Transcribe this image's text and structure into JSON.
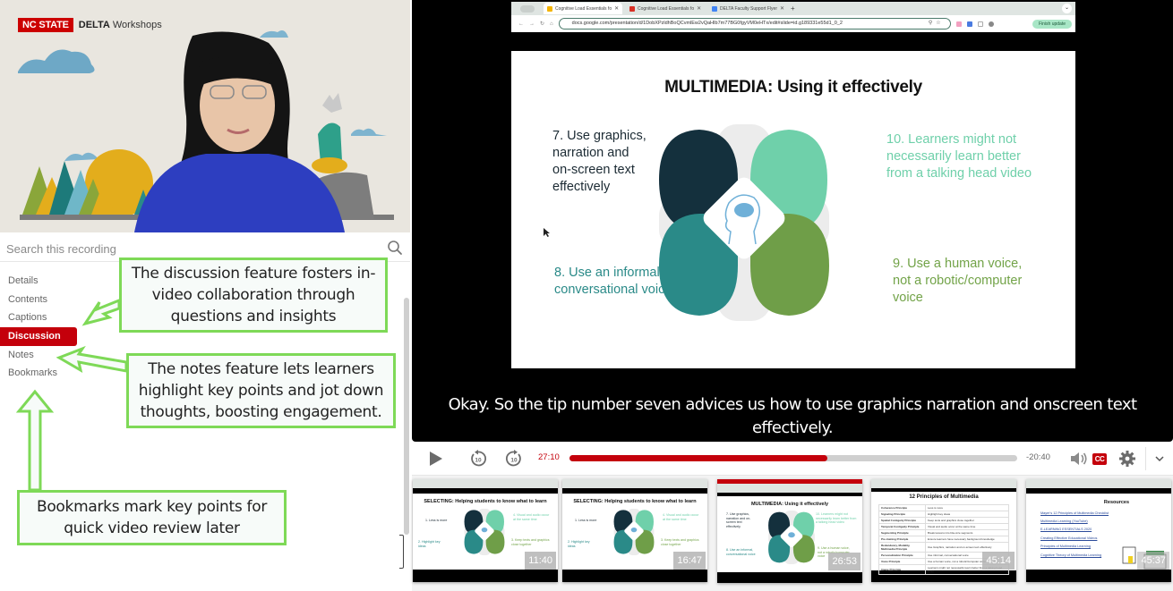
{
  "webcam": {
    "brand_badge": "NC STATE",
    "brand_bold": "DELTA",
    "brand_rest": "Workshops"
  },
  "search": {
    "placeholder": "Search this recording",
    "icon": "search-icon"
  },
  "sidebar": {
    "items": [
      {
        "label": "Details",
        "active": false
      },
      {
        "label": "Contents",
        "active": false
      },
      {
        "label": "Captions",
        "active": false
      },
      {
        "label": "Discussion",
        "active": true
      },
      {
        "label": "Notes",
        "active": false
      },
      {
        "label": "Bookmarks",
        "active": false
      }
    ]
  },
  "annotations": {
    "discussion": "The discussion feature fosters in-video collaboration through questions and insights",
    "notes": "The notes feature lets learners highlight key points and jot down thoughts, boosting engagement.",
    "bookmarks": "Bookmarks mark key points for quick video review later",
    "border_color": "#7ed957"
  },
  "browser": {
    "tabs": [
      {
        "label": "Cognitive Load Essentials fo",
        "active": true,
        "color": "#f4b400"
      },
      {
        "label": "Cognitive Load Essentials fo",
        "active": false,
        "color": "#d93025"
      },
      {
        "label": "DELTA Faculty Support Flyer",
        "active": false,
        "color": "#4285f4"
      }
    ],
    "url": "docs.google.com/presentation/d/1DobXPzldhBoQCvmlEw2vQaHIb7m77BG0fgyVM0eHTx/edit#slide=id.g189331e55d1_0_2",
    "finish_update": "Finish update"
  },
  "slide": {
    "title": "MULTIMEDIA: Using it effectively",
    "tips": [
      {
        "id": "7",
        "text": "7. Use graphics, narration and on-screen text effectively",
        "lines": [
          "7. Use graphics,",
          "narration and",
          "on-screen text",
          "effectively"
        ],
        "color": "#1b2a33"
      },
      {
        "id": "10",
        "text": "10. Learners might not necessarily learn better from a talking head video",
        "lines": [
          "10. Learners might not",
          "necessarily learn better",
          "from a talking head video"
        ],
        "color": "#6fd0aa"
      },
      {
        "id": "8",
        "text": "8. Use an informal, conversational voice",
        "lines": [
          "8. Use an informal,",
          "conversational voice"
        ],
        "color": "#2a8a88"
      },
      {
        "id": "9",
        "text": "9. Use a human voice, not a robotic/computer voice",
        "lines": [
          "9. Use a human voice,",
          "not a robotic/computer",
          "voice"
        ],
        "color": "#72a348"
      }
    ],
    "petal_colors": [
      "#14303d",
      "#6fd0aa",
      "#2a8a88",
      "#6f9e48"
    ]
  },
  "caption": {
    "text": "Okay. So the tip number seven advices us how to use graphics narration and onscreen text effectively."
  },
  "controls": {
    "current_time": "27:10",
    "remaining_time": "-20:40",
    "progress_fraction": 0.575,
    "rewind_seconds": "10",
    "forward_seconds": "10",
    "cc_label": "CC",
    "accent": "#c4000b"
  },
  "thumbnails": [
    {
      "title": "SELECTING: Helping students to know what to learn",
      "time": "11:40",
      "current": false,
      "tips": [
        "1. Less is more",
        "4. Visual and audio occur at the same time",
        "2. Highlight key ideas",
        "3. Keep texts and graphics close together"
      ]
    },
    {
      "title": "SELECTING: Helping students to know what to learn",
      "time": "16:47",
      "current": false,
      "tips": [
        "1. Less is more",
        "4. Visual and audio occur at the same time",
        "2. Highlight key ideas",
        "3. Keep texts and graphics close together"
      ]
    },
    {
      "title": "MULTIMEDIA: Using it effectively",
      "time": "26:53",
      "current": true,
      "tips": [
        "7. Use graphics, narration and on-screen text effectively",
        "10. Learners might not necessarily learn better from a talking head video",
        "8. Use an informal, conversational voice",
        "9. Use a human voice, not a robotic/computer voice"
      ]
    },
    {
      "title": "12 Principles of Multimedia",
      "time": "45:14",
      "current": false,
      "rows": [
        [
          "Coherence Principle",
          "Less is more"
        ],
        [
          "Signaling Principle",
          "Highlight key ideas"
        ],
        [
          "Spatial Contiguity Principle",
          "Keep texts and graphics close together"
        ],
        [
          "Temporal Contiguity Principle",
          "Visual and audio occur at the same time"
        ],
        [
          "Segmenting Principle",
          "Break lessons into bite-size segments"
        ],
        [
          "Pre-training Principle",
          "Ensure learners have necessary background knowledge"
        ],
        [
          "Redundancy, Modality, Multimedia Principle",
          "Use Graphics, narration and on-screen text effectively"
        ],
        [
          "Personalization Principle",
          "Use informal, conversational voice"
        ],
        [
          "Voice Principle",
          "Use a human voice, not a robotic/computer voice"
        ],
        [
          "Image Principle",
          "Learners might not necessarily learn better from a talking head video"
        ]
      ]
    },
    {
      "title": "Resources",
      "time": "45:37",
      "current": false,
      "links": [
        "Mayer's 12 Principles of Multimedia Checklist",
        "Multimedia Learning (YouTube)",
        "E-LEARNING ESSENTIALS 2020",
        "Creating Effective Educational Videos",
        "Principles of Multimedia Learning",
        "Cognitive Theory of Multimedia Learning"
      ]
    }
  ]
}
